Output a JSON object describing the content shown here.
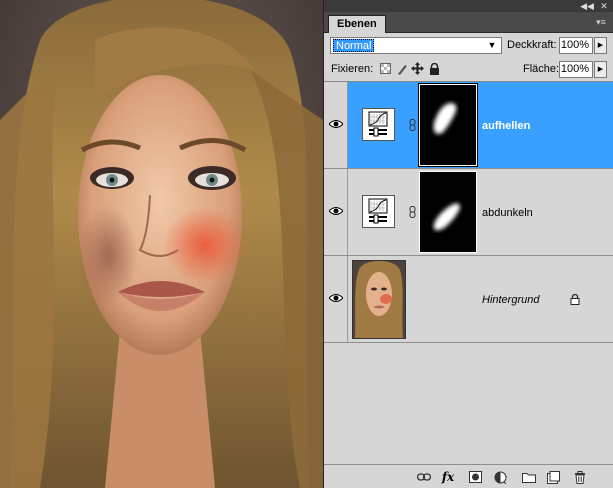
{
  "panel": {
    "tab_label": "Ebenen",
    "collapse_glyph": "◀◀",
    "close_glyph": "✕",
    "menu_glyph": "▾≡"
  },
  "blend": {
    "mode": "Normal",
    "opacity_label": "Deckkraft:",
    "opacity_value": "100%"
  },
  "lock": {
    "label": "Fixieren:",
    "fill_label": "Fläche:",
    "fill_value": "100%"
  },
  "layers": [
    {
      "name": "aufhellen",
      "type": "adjustment-curves",
      "visible": true,
      "selected": true
    },
    {
      "name": "abdunkeln",
      "type": "adjustment-curves",
      "visible": true,
      "selected": false
    },
    {
      "name": "Hintergrund",
      "type": "background",
      "visible": true,
      "selected": false,
      "locked": true
    }
  ],
  "toolbar": {
    "icons": [
      "link-layers-icon",
      "fx-icon",
      "add-mask-icon",
      "adjustment-layer-icon",
      "new-group-icon",
      "new-layer-icon",
      "trash-icon"
    ],
    "fx_label": "fx"
  },
  "colors": {
    "selection": "#3aa0ff",
    "panel_bg": "#d6d6d6",
    "tab_bar": "#4a4a4a"
  }
}
